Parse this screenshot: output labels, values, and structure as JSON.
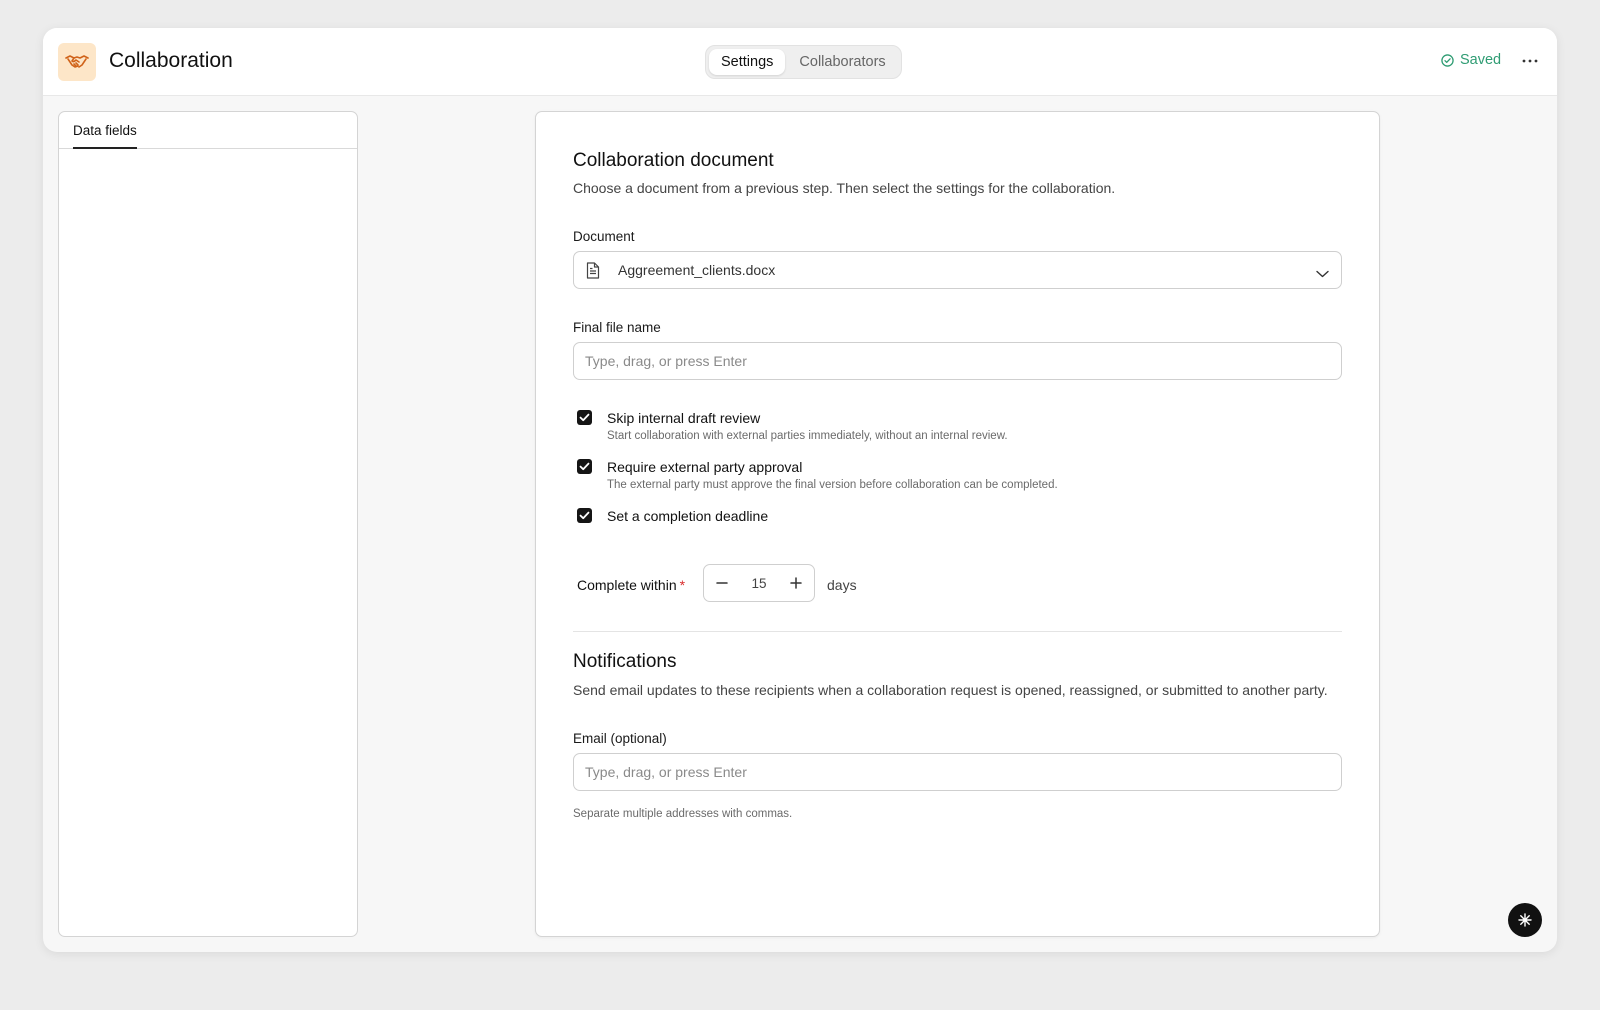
{
  "header": {
    "title": "Collaboration",
    "app_icon": "handshake-icon",
    "tabs": [
      {
        "label": "Settings",
        "active": true
      },
      {
        "label": "Collaborators",
        "active": false
      }
    ],
    "status": "Saved",
    "status_icon": "check-circle-icon",
    "more_icon": "ellipsis-icon"
  },
  "sidebar": {
    "tabs": [
      {
        "label": "Data fields",
        "active": true
      }
    ]
  },
  "collaboration": {
    "title": "Collaboration document",
    "description": "Choose a document from a previous step. Then select the settings for the collaboration.",
    "document": {
      "label": "Document",
      "value": "Aggreement_clients.docx",
      "icon": "document-icon"
    },
    "final_file_name": {
      "label": "Final file name",
      "placeholder": "Type, drag, or press Enter",
      "value": ""
    },
    "options": [
      {
        "label": "Skip internal draft review",
        "help": "Start collaboration with external parties immediately, without an internal review.",
        "checked": true
      },
      {
        "label": "Require external party approval",
        "help": "The external party must approve the final version before collaboration can be completed.",
        "checked": true
      },
      {
        "label": "Set a completion deadline",
        "help": "",
        "checked": true
      }
    ],
    "deadline": {
      "label": "Complete within",
      "required_mark": "*",
      "value": "15",
      "unit": "days"
    }
  },
  "notifications": {
    "title": "Notifications",
    "description": "Send email updates to these recipients when a collaboration request is opened, reassigned, or submitted to another party.",
    "email": {
      "label": "Email (optional)",
      "placeholder": "Type, drag, or press Enter",
      "value": "",
      "hint": "Separate multiple addresses with commas."
    }
  },
  "colors": {
    "accent_saved": "#2f9c73",
    "app_icon_bg": "#fde6c8",
    "app_icon_stroke": "#d0631a",
    "required": "#d92d2d"
  },
  "fab_icon": "sparkle-icon"
}
